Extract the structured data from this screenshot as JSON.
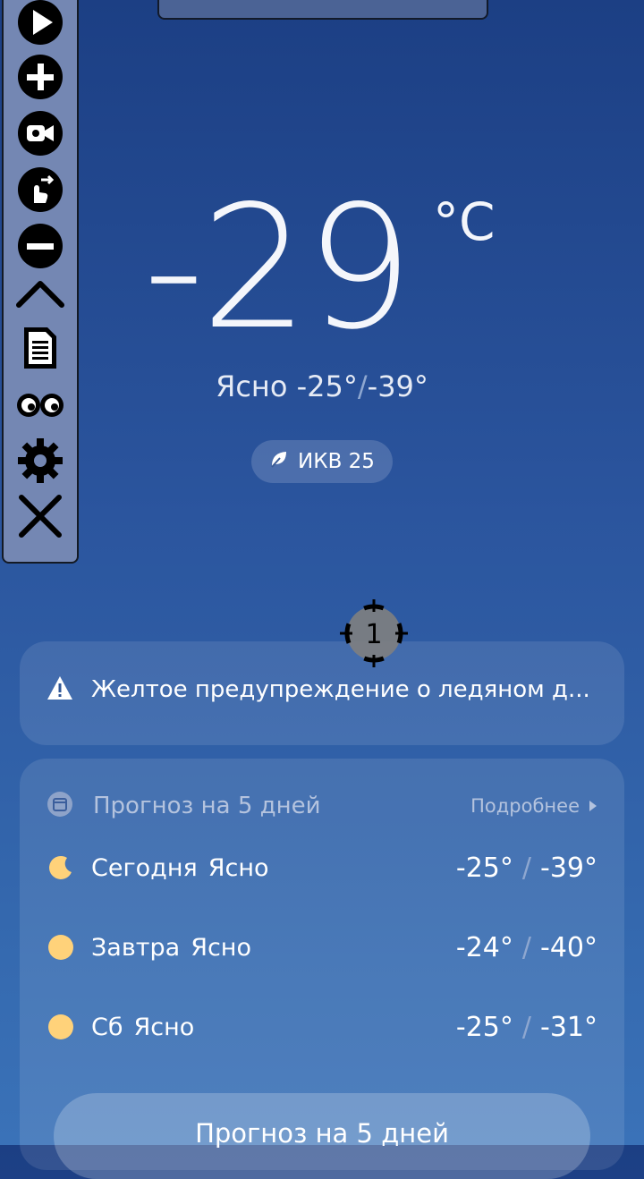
{
  "current": {
    "temperature": "-29",
    "unit": "°C",
    "condition": "Ясно",
    "high": "-25°",
    "low": "-39°",
    "aqi_label": "ИКВ 25"
  },
  "alert": {
    "text": "Желтое предупреждение о ледяном д..."
  },
  "forecast": {
    "title": "Прогноз на 5 дней",
    "more_label": "Подробнее",
    "days": [
      {
        "day": "Сегодня",
        "condition": "Ясно",
        "high": "-25°",
        "low": "-39°",
        "icon": "moon-icon"
      },
      {
        "day": "Завтра",
        "condition": "Ясно",
        "high": "-24°",
        "low": "-40°",
        "icon": "sun-icon"
      },
      {
        "day": "Сб",
        "condition": "Ясно",
        "high": "-25°",
        "low": "-31°",
        "icon": "sun-icon"
      }
    ]
  },
  "bottom_button": {
    "label": "Прогноз на 5 дней"
  },
  "overlay": {
    "marker_number": "1",
    "toolbar_icons": [
      "play-icon",
      "plus-icon",
      "camera-icon",
      "swipe-icon",
      "minus-icon",
      "chevron-up-icon",
      "document-icon",
      "eyes-icon",
      "gear-icon",
      "close-icon"
    ]
  },
  "colors": {
    "bg_top": "#1c3f84",
    "bg_bottom": "#3a72b8",
    "sun": "#ffd27a",
    "toolbar": "#7487b3"
  }
}
